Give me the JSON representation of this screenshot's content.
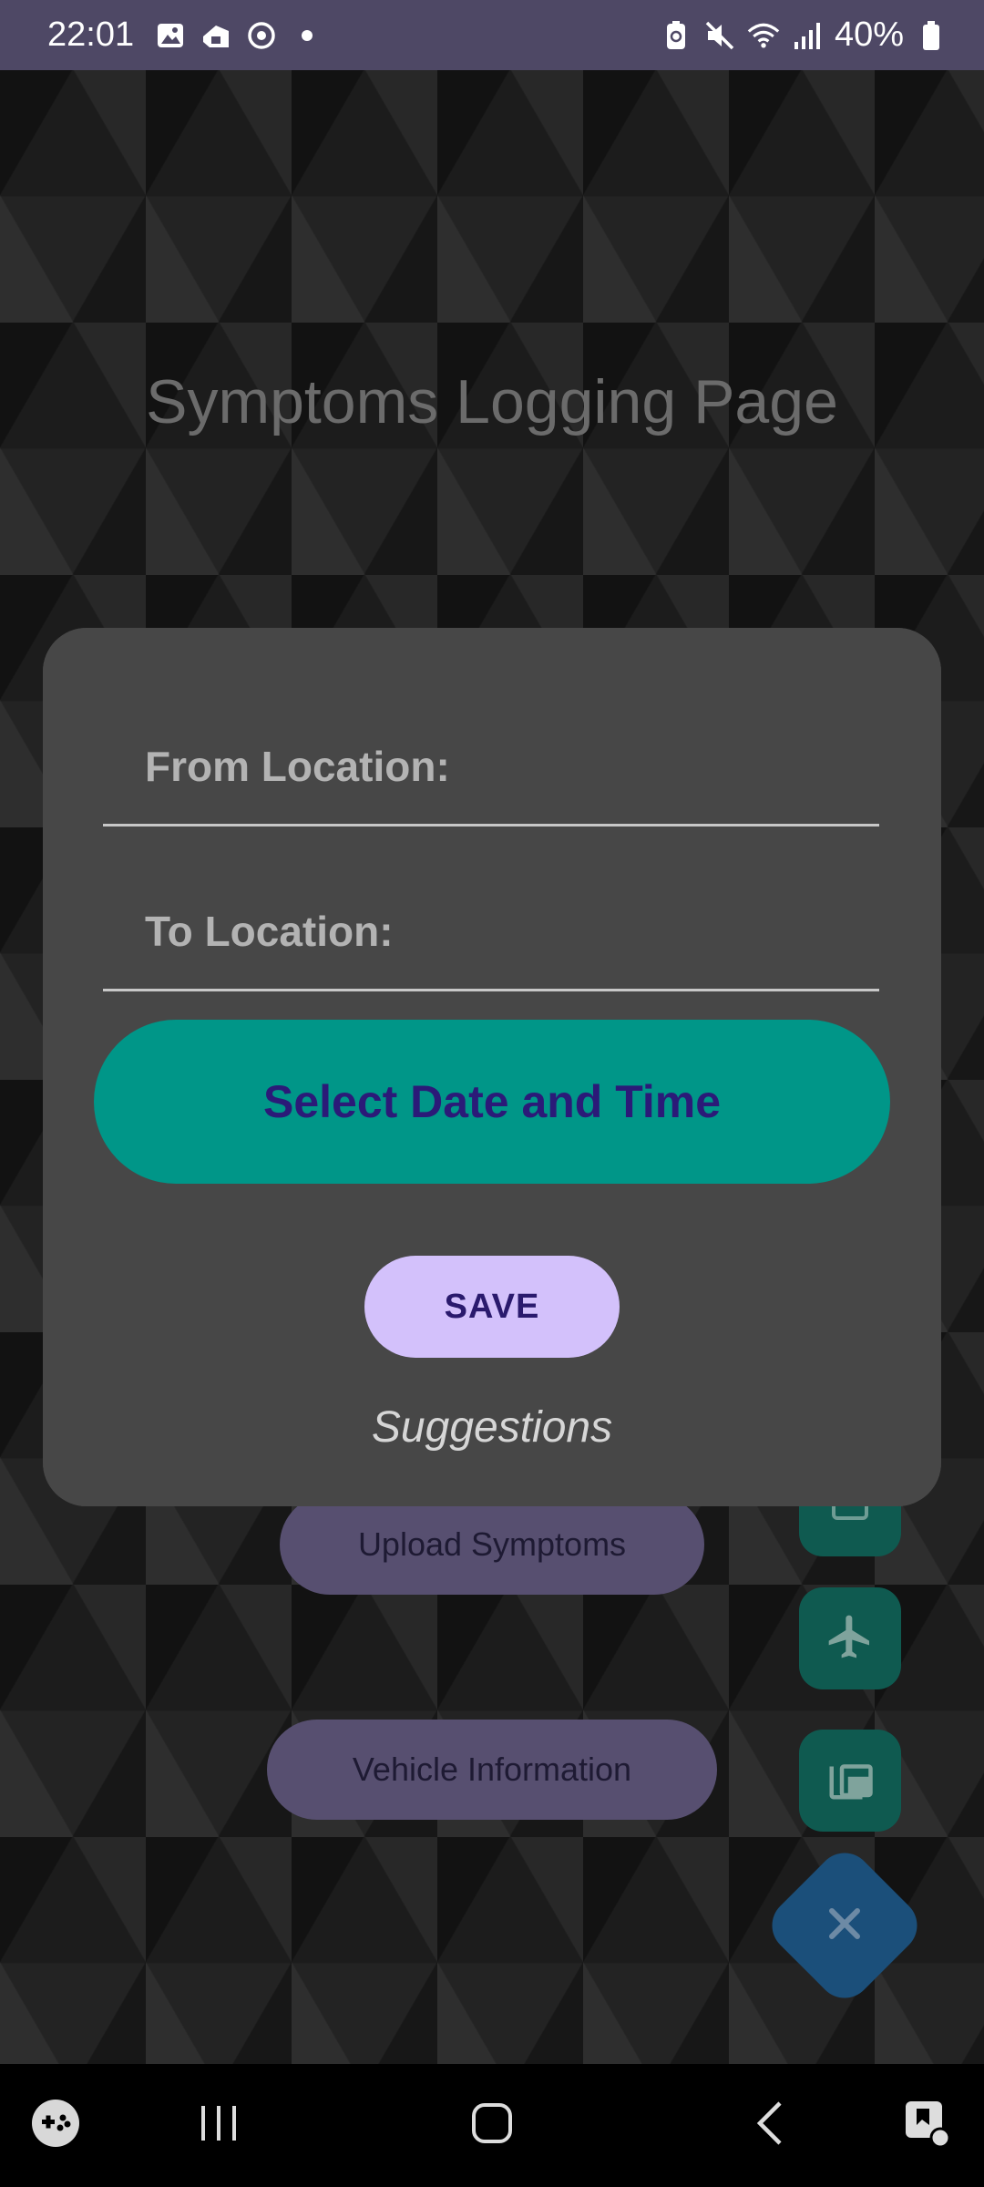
{
  "status_bar": {
    "time": "22:01",
    "battery": "40%",
    "left_icons": [
      "gallery-icon",
      "app-icon",
      "sync-icon",
      "dot-icon"
    ],
    "right_icons": [
      "battery-saver-icon",
      "mute-icon",
      "wifi-icon",
      "signal-icon",
      "battery-icon"
    ]
  },
  "page": {
    "title": "Symptoms Logging Page",
    "buttons": {
      "upload": "Upload Symptoms",
      "vehicle": "Vehicle Information"
    }
  },
  "dialog": {
    "from_label": "From Location:",
    "to_label": "To Location:",
    "select_datetime": "Select Date and Time",
    "save": "SAVE",
    "suggestions": "Suggestions"
  },
  "fabs": [
    "calendar-icon",
    "airplane-icon",
    "copy-icon",
    "close-icon"
  ],
  "colors": {
    "accent_teal": "#009688",
    "save_button": "#d3c1fb",
    "dialog_bg": "#474747",
    "status_bar": "#4e4865"
  }
}
